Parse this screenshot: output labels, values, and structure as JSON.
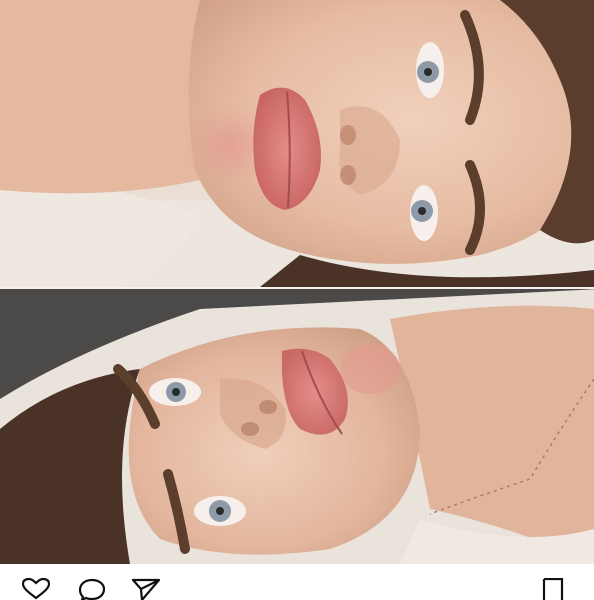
{
  "post": {
    "images": [
      {
        "name": "top-photo"
      },
      {
        "name": "bottom-photo"
      }
    ]
  },
  "action_bar": {
    "icons": [
      "heart-icon",
      "comment-icon",
      "share-icon",
      "bookmark-icon"
    ]
  },
  "colors": {
    "background": "#ffffff",
    "icon_stroke": "#111111",
    "skin": "#e9c3ad",
    "lips": "#d9787a",
    "sweater": "#ece5dd",
    "hair": "#4a3326"
  }
}
